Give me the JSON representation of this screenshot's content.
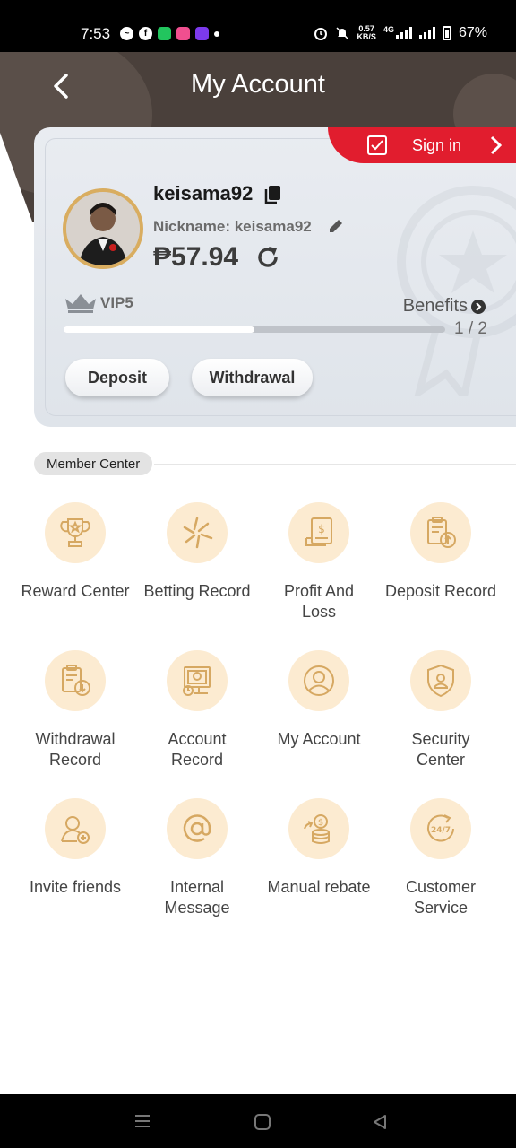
{
  "status_bar": {
    "time": "7:53",
    "net_speed_value": "0.57",
    "net_speed_unit": "KB/S",
    "network": "4G",
    "battery": "67%"
  },
  "header": {
    "title": "My Account"
  },
  "account": {
    "sign_in_label": "Sign in",
    "username": "keisama92",
    "nickname": "Nickname: keisama92",
    "balance": "₱57.94",
    "vip_level": "VIP5",
    "benefits_label": "Benefits",
    "progress_text": "1 / 2",
    "progress_fraction": 0.5,
    "deposit_label": "Deposit",
    "withdrawal_label": "Withdrawal"
  },
  "member_center": {
    "section_label": "Member Center",
    "items": [
      {
        "label": "Reward Center",
        "icon": "trophy-icon"
      },
      {
        "label": "Betting Record",
        "icon": "star-burst-icon"
      },
      {
        "label": "Profit And\nLoss",
        "icon": "document-dollar-icon"
      },
      {
        "label": "Deposit Record",
        "icon": "clipboard-upload-icon"
      },
      {
        "label": "Withdrawal\nRecord",
        "icon": "clipboard-download-icon"
      },
      {
        "label": "Account\nRecord",
        "icon": "account-record-icon"
      },
      {
        "label": "My Account",
        "icon": "user-circle-icon"
      },
      {
        "label": "Security\nCenter",
        "icon": "shield-user-icon"
      },
      {
        "label": "Invite friends",
        "icon": "user-add-icon"
      },
      {
        "label": "Internal\nMessage",
        "icon": "at-sign-icon"
      },
      {
        "label": "Manual rebate",
        "icon": "coins-icon"
      },
      {
        "label": "Customer\nService",
        "icon": "support-24-7-icon"
      }
    ]
  },
  "colors": {
    "header_bg": "#4a403b",
    "sign_in_red": "#e11d2e",
    "icon_circle_bg": "#fcebd1",
    "icon_stroke": "#d6a862"
  }
}
